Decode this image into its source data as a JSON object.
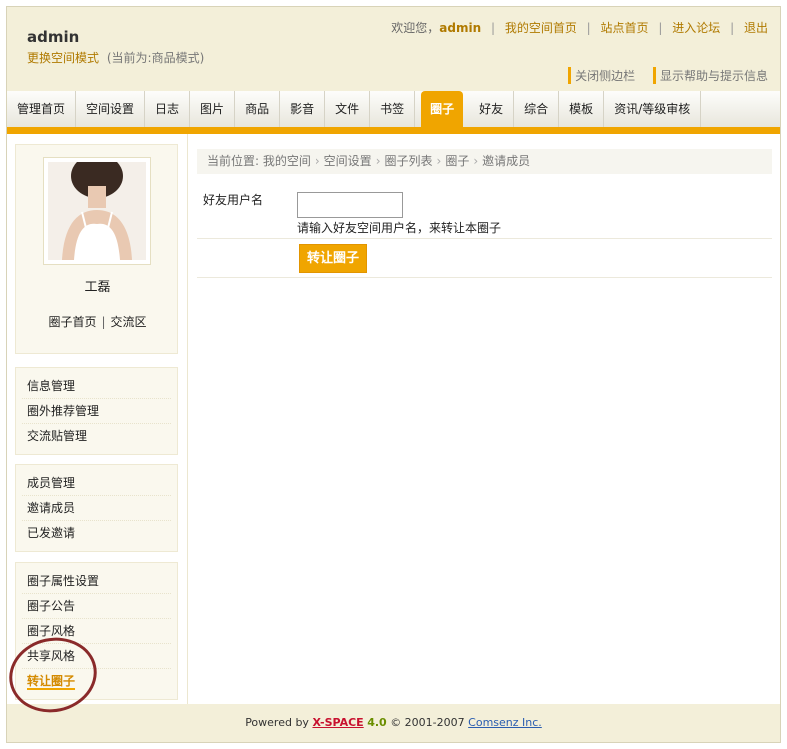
{
  "header": {
    "user_name": "admin",
    "mode_link": "更换空间模式",
    "mode_current": "(当前为:商品模式)",
    "welcome_prefix": "欢迎您，",
    "welcome_user": "admin",
    "links": [
      "我的空间首页",
      "站点首页",
      "进入论坛",
      "退出"
    ],
    "toggles": [
      "关闭侧边栏",
      "显示帮助与提示信息"
    ]
  },
  "nav": {
    "tabs": [
      {
        "label": "管理首页",
        "active": false
      },
      {
        "label": "空间设置",
        "active": false
      },
      {
        "label": "日志",
        "active": false
      },
      {
        "label": "图片",
        "active": false
      },
      {
        "label": "商品",
        "active": false
      },
      {
        "label": "影音",
        "active": false
      },
      {
        "label": "文件",
        "active": false
      },
      {
        "label": "书签",
        "active": false
      },
      {
        "label": "圈子",
        "active": true
      },
      {
        "label": "好友",
        "active": false
      },
      {
        "label": "综合",
        "active": false
      },
      {
        "label": "模板",
        "active": false
      },
      {
        "label": "资讯/等级审核",
        "active": false
      }
    ]
  },
  "sidebar": {
    "profile_name": "工磊",
    "profile_links": [
      "圈子首页",
      "交流区"
    ],
    "menu_groups": [
      [
        "信息管理",
        "圈外推荐管理",
        "交流贴管理"
      ],
      [
        "成员管理",
        "邀请成员",
        "已发邀请"
      ],
      [
        "圈子属性设置",
        "圈子公告",
        "圈子风格",
        "共享风格",
        "转让圈子"
      ]
    ],
    "current_item": "转让圈子"
  },
  "main": {
    "breadcrumb": [
      "当前位置: 我的空间",
      "空间设置",
      "圈子列表",
      "圈子",
      "邀请成员"
    ],
    "field_label": "好友用户名",
    "field_value": "",
    "field_hint": "请输入好友空间用户名，来转让本圈子",
    "submit_label": "转让圈子"
  },
  "footer": {
    "powered_by": "Powered by",
    "brand": "X-SPACE",
    "version": "4.0",
    "copyright": "© 2001-2007",
    "company": "Comsenz Inc."
  },
  "colors": {
    "accent": "#f0a500",
    "background": "#f3efd9",
    "link": "#b07a00"
  }
}
